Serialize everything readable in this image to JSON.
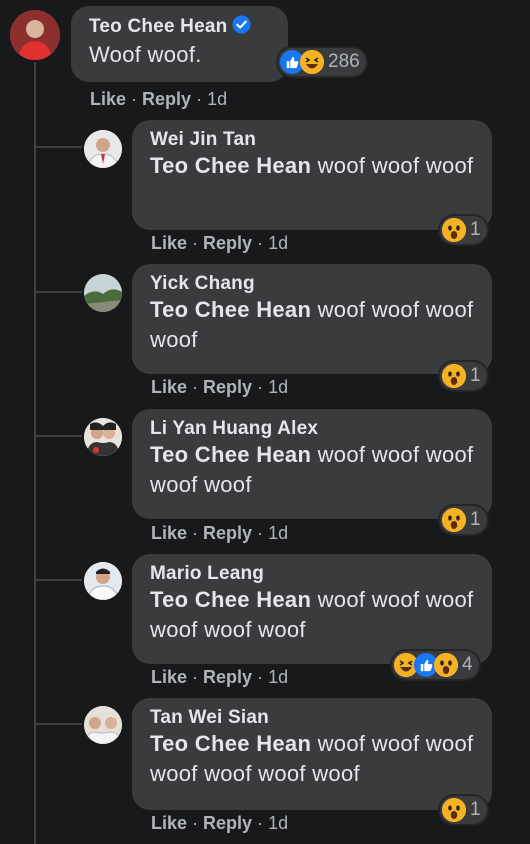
{
  "top": {
    "author": "Teo Chee Hean",
    "text": "Woof woof.",
    "reaction_count": "286",
    "actions": {
      "like": "Like",
      "reply": "Reply",
      "time": "1d"
    }
  },
  "replies": [
    {
      "author": "Wei Jin Tan",
      "mention": "Teo Chee Hean",
      "text": " woof woof woof",
      "reaction_count": "1",
      "like": "Like",
      "reply": "Reply",
      "time": "1d"
    },
    {
      "author": "Yick Chang",
      "mention": "Teo Chee Hean",
      "text": " woof woof woof woof",
      "reaction_count": "1",
      "like": "Like",
      "reply": "Reply",
      "time": "1d"
    },
    {
      "author": "Li Yan Huang Alex",
      "mention": "Teo Chee Hean",
      "text": " woof woof woof woof woof",
      "reaction_count": "1",
      "like": "Like",
      "reply": "Reply",
      "time": "1d"
    },
    {
      "author": "Mario Leang",
      "mention": "Teo Chee Hean",
      "text": " woof woof woof woof woof woof",
      "reaction_count": "4",
      "like": "Like",
      "reply": "Reply",
      "time": "1d"
    },
    {
      "author": "Tan Wei Sian",
      "mention": "Teo Chee Hean",
      "text": " woof woof woof woof woof woof woof",
      "reaction_count": "1",
      "like": "Like",
      "reply": "Reply",
      "time": "1d"
    }
  ],
  "colors": {
    "background": "#18191a",
    "bubble": "#3a3b3c",
    "meta": "#b0b3b8",
    "verified": "#1877f2"
  },
  "icons": [
    "verified-badge-icon",
    "like-reaction-icon",
    "haha-reaction-icon",
    "wow-reaction-icon"
  ]
}
